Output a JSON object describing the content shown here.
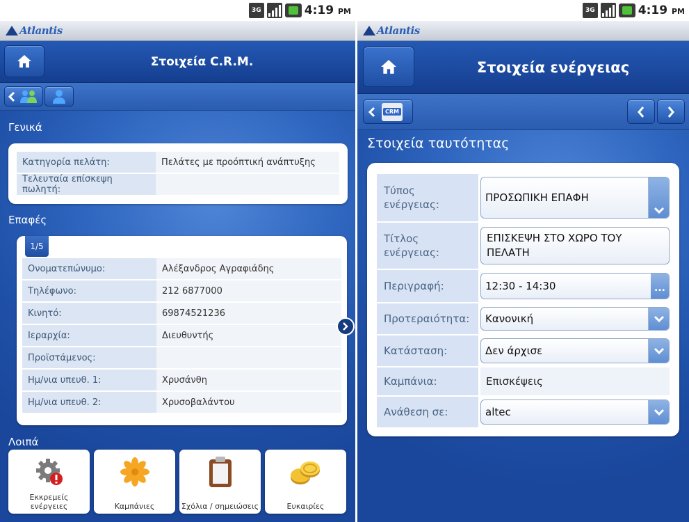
{
  "status_bar": {
    "network": "3G",
    "time": "4:19",
    "ampm": "PM"
  },
  "app": {
    "logo": "Atlantis"
  },
  "left_screen": {
    "title": "Στοιχεία C.R.M.",
    "sections": {
      "general": "Γενικά",
      "contacts": "Επαφές",
      "other": "Λοιπά"
    },
    "general_rows": [
      {
        "label": "Κατηγορία πελάτη:",
        "value": "Πελάτες με προόπτική ανάπτυξης"
      },
      {
        "label": "Τελευταία επίσκεψη πωλητή:",
        "value": ""
      }
    ],
    "contacts_pager": "1/5",
    "contact_rows": [
      {
        "label": "Ονοματεπώνυμο:",
        "value": "Αλέξανδρος Αγραφιάδης"
      },
      {
        "label": "Τηλέφωνο:",
        "value": "212 6877000"
      },
      {
        "label": "Κινητό:",
        "value": "69874521236"
      },
      {
        "label": "Ιεραρχία:",
        "value": "Διευθυντής"
      },
      {
        "label": "Προϊστάμενος:",
        "value": ""
      },
      {
        "label": "Ημ/νια υπευθ. 1:",
        "value": "Χρυσάνθη"
      },
      {
        "label": "Ημ/νια υπευθ. 2:",
        "value": "Χρυσοβαλάντου"
      }
    ],
    "tiles": [
      {
        "label": "Εκκρεμείς ενέργειες",
        "icon": "gear-warning-icon"
      },
      {
        "label": "Καμπάνιες",
        "icon": "flower-icon"
      },
      {
        "label": "Σχόλια / σημειώσεις",
        "icon": "clipboard-icon"
      },
      {
        "label": "Ευκαιρίες",
        "icon": "coins-icon"
      }
    ]
  },
  "right_screen": {
    "title": "Στοιχεία ενέργειας",
    "crm_badge": "CRM",
    "section": "Στοιχεία ταυτότητας",
    "fields": {
      "type": {
        "label": "Τύπος ενέργειας:",
        "value": "ΠΡΟΣΩΠΙΚΗ ΕΠΑΦΗ"
      },
      "title": {
        "label": "Τίτλος ενέργειας:",
        "value": "ΕΠΙΣΚΕΨΗ ΣΤΟ ΧΩΡΟ ΤΟΥ ΠΕΛΑΤΗ"
      },
      "description": {
        "label": "Περιγραφή:",
        "value": "12:30 - 14:30"
      },
      "priority": {
        "label": "Προτεραιότητα:",
        "value": "Κανονική"
      },
      "status": {
        "label": "Κατάσταση:",
        "value": "Δεν άρχισε"
      },
      "campaign": {
        "label": "Καμπάνια:",
        "value": "Επισκέψεις"
      },
      "assigned": {
        "label": "Ανάθεση σε:",
        "value": "altec"
      }
    }
  }
}
